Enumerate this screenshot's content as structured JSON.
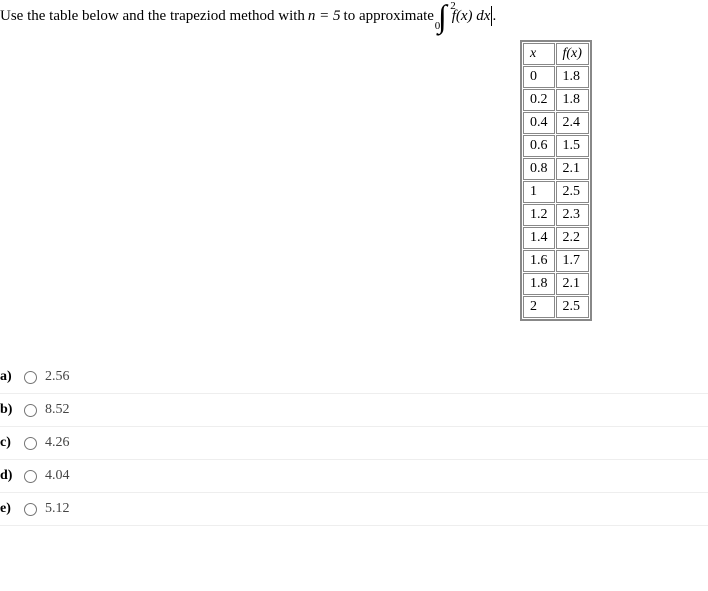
{
  "question": {
    "prefix": "Use the table below and the trapeziod method with ",
    "n_eq": "n = 5",
    "middle": " to approximate ",
    "integral_lower": "0",
    "integral_upper": "2",
    "integrand": "f(x) dx",
    "period": "."
  },
  "table": {
    "headers": {
      "x": "x",
      "fx": "f(x)"
    },
    "rows": [
      {
        "x": "0",
        "fx": "1.8"
      },
      {
        "x": "0.2",
        "fx": "1.8"
      },
      {
        "x": "0.4",
        "fx": "2.4"
      },
      {
        "x": "0.6",
        "fx": "1.5"
      },
      {
        "x": "0.8",
        "fx": "2.1"
      },
      {
        "x": "1",
        "fx": "2.5"
      },
      {
        "x": "1.2",
        "fx": "2.3"
      },
      {
        "x": "1.4",
        "fx": "2.2"
      },
      {
        "x": "1.6",
        "fx": "1.7"
      },
      {
        "x": "1.8",
        "fx": "2.1"
      },
      {
        "x": "2",
        "fx": "2.5"
      }
    ]
  },
  "options": [
    {
      "label": "a)",
      "value": "2.56"
    },
    {
      "label": "b)",
      "value": "8.52"
    },
    {
      "label": "c)",
      "value": "4.26"
    },
    {
      "label": "d)",
      "value": "4.04"
    },
    {
      "label": "e)",
      "value": "5.12"
    }
  ]
}
